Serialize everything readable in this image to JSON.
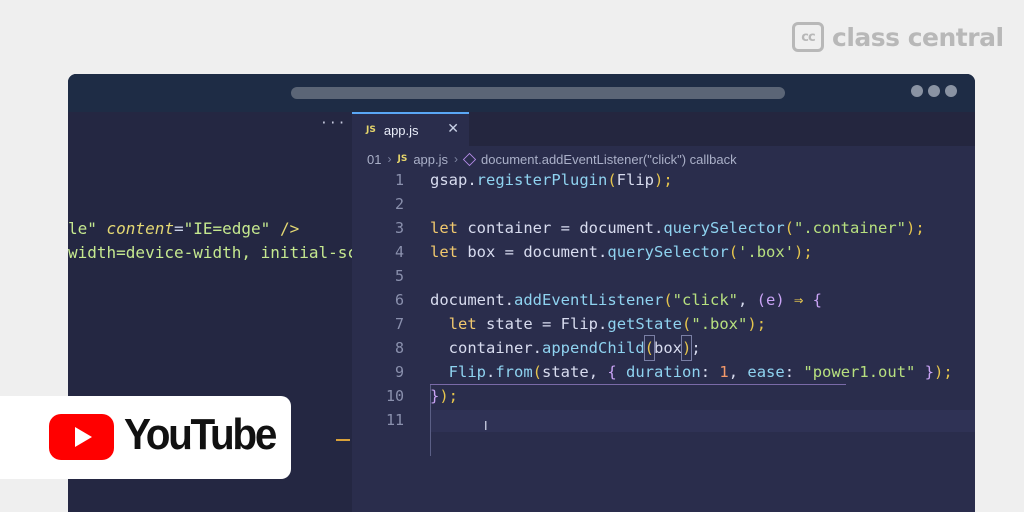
{
  "brand": {
    "mark": "cc",
    "name": "class central"
  },
  "window": {
    "menu_dots": "•••",
    "left_menu": "···",
    "left_lines": [
      {
        "a": "le\" ",
        "attr": "content",
        "eq": "=",
        "val": "\"IE=edge\"",
        "end": " />"
      },
      {
        "text": "width=device-width, initial-sc"
      }
    ]
  },
  "editor": {
    "tab": {
      "icon": "JS",
      "name": "app.js",
      "close": "✕"
    },
    "breadcrumb": {
      "folder": "01",
      "file_icon": "JS",
      "file": "app.js",
      "symbol_icon": "cube-icon",
      "symbol": "document.addEventListener(\"click\") callback"
    },
    "line_numbers": [
      "1",
      "2",
      "3",
      "4",
      "5",
      "6",
      "7",
      "8",
      "9",
      "10",
      "11"
    ],
    "code": {
      "l1": {
        "obj": "gsap",
        "dot": ".",
        "fn": "registerPlugin",
        "p1": "(",
        "arg": "Flip",
        "p2": ");"
      },
      "l3": {
        "kw": "let",
        "name": " container ",
        "eq": "=",
        "obj": " document",
        "dot": ".",
        "fn": "querySelector",
        "p1": "(",
        "str": "\".container\"",
        "p2": ");"
      },
      "l4": {
        "kw": "let",
        "name": " box ",
        "eq": "=",
        "obj": " document",
        "dot": ".",
        "fn": "querySelector",
        "p1": "(",
        "str": "'.box'",
        "p2": ");"
      },
      "l6": {
        "obj": "document",
        "dot": ".",
        "fn": "addEventListener",
        "p1": "(",
        "str": "\"click\"",
        "comma": ", ",
        "argp": "(e)",
        "arrow": " ⇒ ",
        "brace": "{"
      },
      "l7": {
        "kw": "let",
        "name": " state ",
        "eq": "=",
        "obj": " Flip",
        "dot": ".",
        "fn": "getState",
        "p1": "(",
        "str": "\".box\"",
        "p2": ");"
      },
      "l8": {
        "obj": "container",
        "dot": ".",
        "fn": "appendChild",
        "p1": "(",
        "arg": "box",
        "p2": ")",
        "end": ";"
      },
      "l9": {
        "obj": "Flip",
        "dot": ".",
        "fn": "from",
        "p1": "(",
        "a1": "state",
        "c1": ", ",
        "b1": "{",
        "k1": " duration",
        "c2": ": ",
        "n1": "1",
        "c3": ", ",
        "k2": "ease",
        "c4": ": ",
        "s1": "\"power1.out\"",
        "b2": " }",
        "p2": ");"
      },
      "l10": {
        "brace": "}",
        "end": ");"
      }
    }
  },
  "youtube": {
    "wordmark": "YouTube"
  }
}
